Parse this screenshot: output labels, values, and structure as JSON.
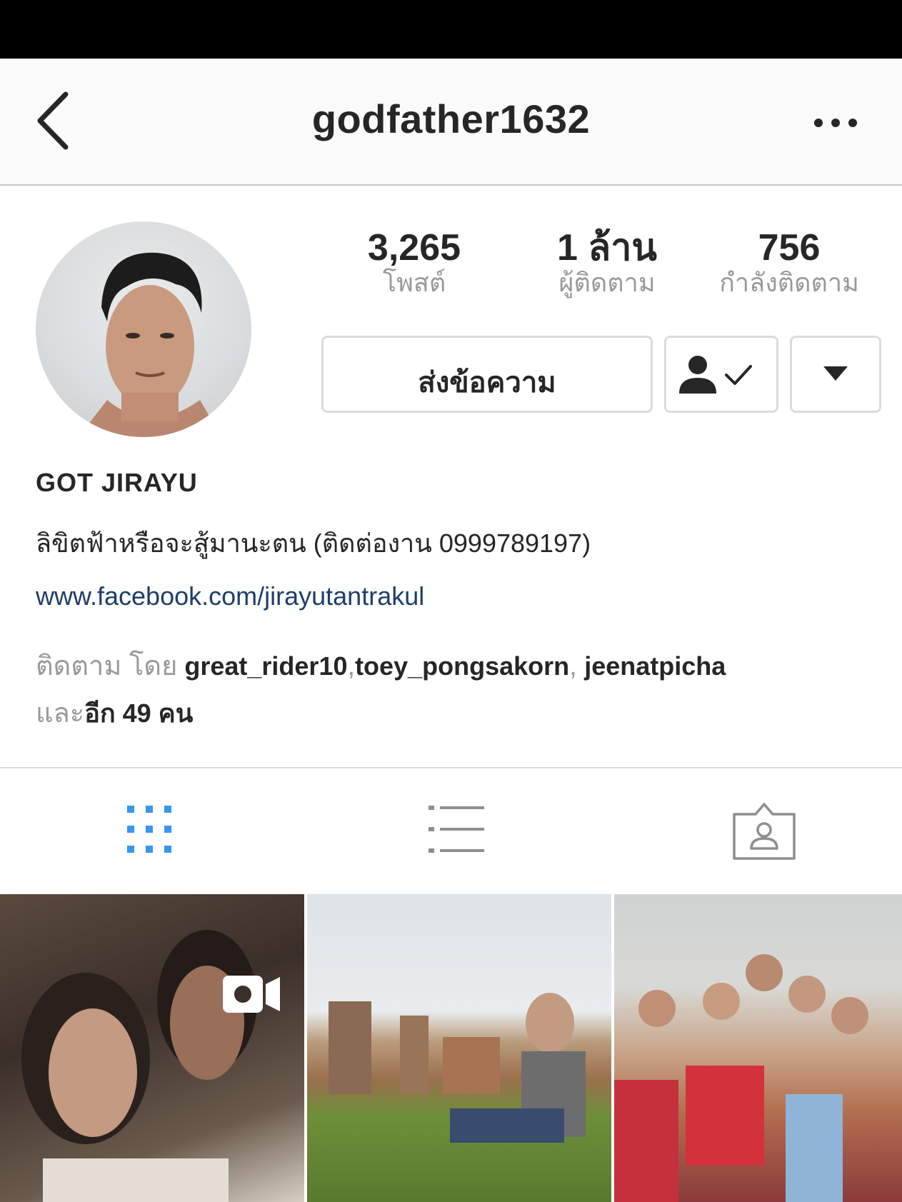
{
  "header": {
    "username": "godfather1632",
    "back_icon": "chevron-left-icon",
    "more_icon": "more-horizontal-icon"
  },
  "stats": [
    {
      "value": "3,265",
      "label": "โพสต์"
    },
    {
      "value": "1 ล้าน",
      "label": "ผู้ติดตาม"
    },
    {
      "value": "756",
      "label": "กำลังติดตาม"
    }
  ],
  "actions": {
    "message_label": "ส่งข้อความ",
    "following_icon": "person-check-icon",
    "dropdown_icon": "caret-down-icon"
  },
  "profile": {
    "display_name": "GOT JIRAYU",
    "bio": "ลิขิตฟ้าหรือจะสู้มานะตน (ติดต่องาน 0999789197)",
    "website": "www.facebook.com/jirayutantrakul"
  },
  "followed_by": {
    "prefix": "ติดตาม โดย",
    "users": [
      "great_rider10",
      "toey_pongsakorn",
      "jeenatpicha"
    ],
    "sep1": ",",
    "sep2": ", ",
    "and_label": "และ",
    "others": "อีก 49 คน"
  },
  "tabs": [
    {
      "icon": "grid-icon",
      "active": true
    },
    {
      "icon": "list-icon",
      "active": false
    },
    {
      "icon": "tagged-icon",
      "active": false
    }
  ],
  "photos": [
    {
      "type": "video",
      "badge_icon": "video-camera-icon"
    },
    {
      "type": "image"
    },
    {
      "type": "image"
    }
  ],
  "colors": {
    "active_tab": "#3897f0",
    "inactive_tab": "#8e8e8e",
    "link": "#1f3e6b",
    "muted_text": "#999999"
  }
}
